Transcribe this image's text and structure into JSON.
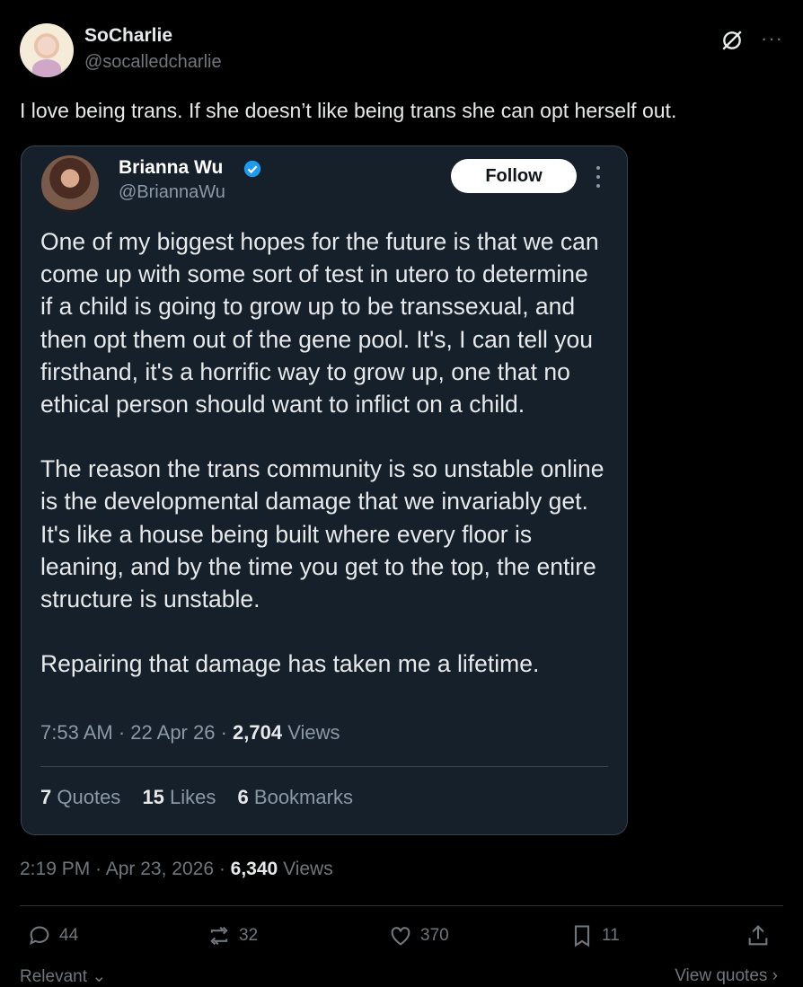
{
  "post": {
    "author": {
      "name": "SoCharlie",
      "handle": "@socalledcharlie"
    },
    "text": "I love being trans. If she doesn’t like being trans she can opt herself out.",
    "time": "2:19 PM",
    "date": "Apr 23, 2026",
    "views_count": "6,340",
    "views_label": "Views",
    "stats": {
      "replies": "44",
      "reposts": "32",
      "likes": "370",
      "bookmarks": "11"
    }
  },
  "quote": {
    "author": {
      "name": "Brianna Wu",
      "handle": "@BriannaWu"
    },
    "follow_label": "Follow",
    "paragraphs": [
      "One of my biggest hopes for the future is that we can come up with some sort of test in utero to determine if a child is going to grow up to be transsexual, and then opt them out of the gene pool. It's, I can tell you firsthand, it's a horrific way to grow up, one that no ethical person should want to inflict on a child.",
      "The reason the trans community is so unstable online is the developmental damage that we invariably get. It's like a house being built where every floor is leaning, and by the time you get to the top, the entire structure is unstable.",
      "Repairing that damage has taken me a lifetime."
    ],
    "time": "7:53 AM",
    "date": "22 Apr 26",
    "views_count": "2,704",
    "views_label": "Views",
    "quotes_count": "7",
    "quotes_label": "Quotes",
    "likes_count": "15",
    "likes_label": "Likes",
    "bookmarks_count": "6",
    "bookmarks_label": "Bookmarks"
  },
  "footer": {
    "left": "Relevant",
    "right": "View quotes"
  },
  "icons": {
    "grok": "grok-icon",
    "more": "more-icon",
    "verified": "verified-icon",
    "reply": "reply-icon",
    "repost": "repost-icon",
    "like": "heart-icon",
    "bookmark": "bookmark-icon",
    "share": "share-icon"
  },
  "colors": {
    "background": "#000000",
    "card": "#15202b",
    "verified": "#1d9bf0",
    "muted": "#71767b"
  }
}
